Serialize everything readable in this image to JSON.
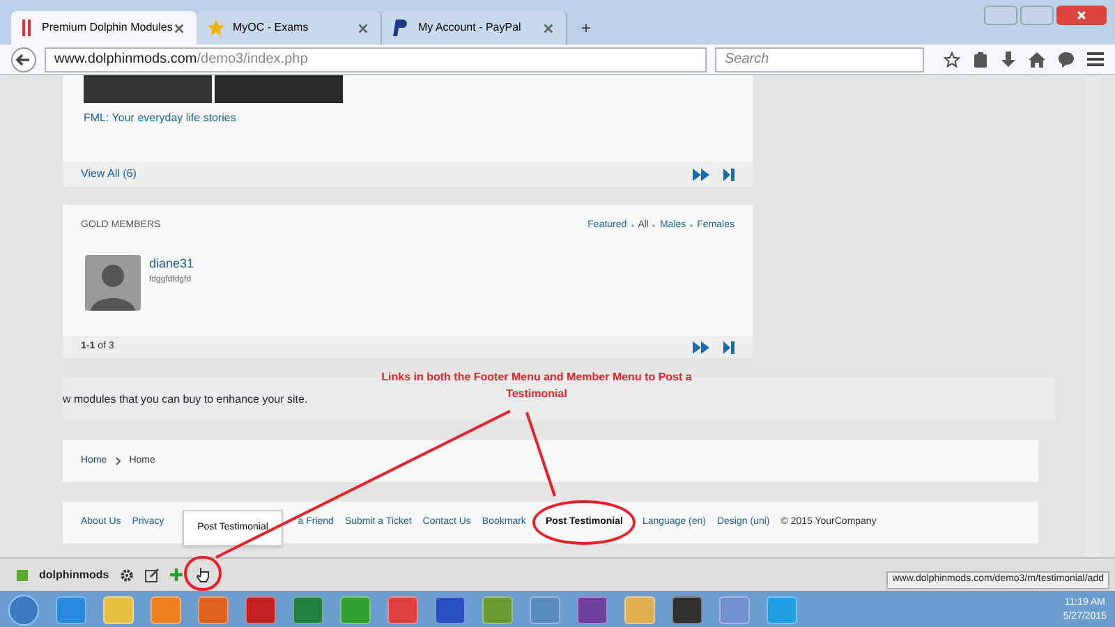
{
  "browser": {
    "tabs": [
      {
        "label": "Premium Dolphin Modules",
        "selected": true,
        "kind": "dolphin"
      },
      {
        "label": "MyOC - Exams",
        "selected": false,
        "kind": "star"
      },
      {
        "label": "My Account - PayPal",
        "selected": false,
        "kind": "paypal"
      }
    ],
    "new_tab": "+",
    "url_host": "www.dolphinmods.com",
    "url_path": "/demo3/index.php",
    "search_placeholder": "Search"
  },
  "featured_card": {
    "link": "FML: Your everyday life stories",
    "view_all": "View All (6)"
  },
  "gold_members": {
    "title": "GOLD MEMBERS",
    "filters": [
      {
        "label": "Featured",
        "selected": false
      },
      {
        "label": "All",
        "selected": true
      },
      {
        "label": "Males",
        "selected": false
      },
      {
        "label": "Females",
        "selected": false
      }
    ],
    "members": [
      {
        "name": "diane31",
        "status": "fdggfdfdgfd"
      }
    ],
    "pagination": "**1-1** of 3"
  },
  "banner": "w modules that you can buy to enhance your site.",
  "breadcrumb": [
    "Home",
    "Home"
  ],
  "footer": {
    "links_before": [
      "About Us",
      "Privacy"
    ],
    "links_after": [
      "a Friend",
      "Submit a Ticket",
      "Contact Us",
      "Bookmark",
      "Post Testimonial",
      "Language (en)",
      "Design (uni)"
    ],
    "copyright": "© 2015 YourCompany"
  },
  "popup": "Post Testimonial",
  "annotation": "Links in both the Footer Menu and Member Menu to Post a Testimonial",
  "member_toolbar": {
    "label": "dolphinmods"
  },
  "status_url": "www.dolphinmods.com/demo3/m/testimonial/add",
  "clock": {
    "time": "11:19 AM",
    "date": "5/27/2015"
  }
}
